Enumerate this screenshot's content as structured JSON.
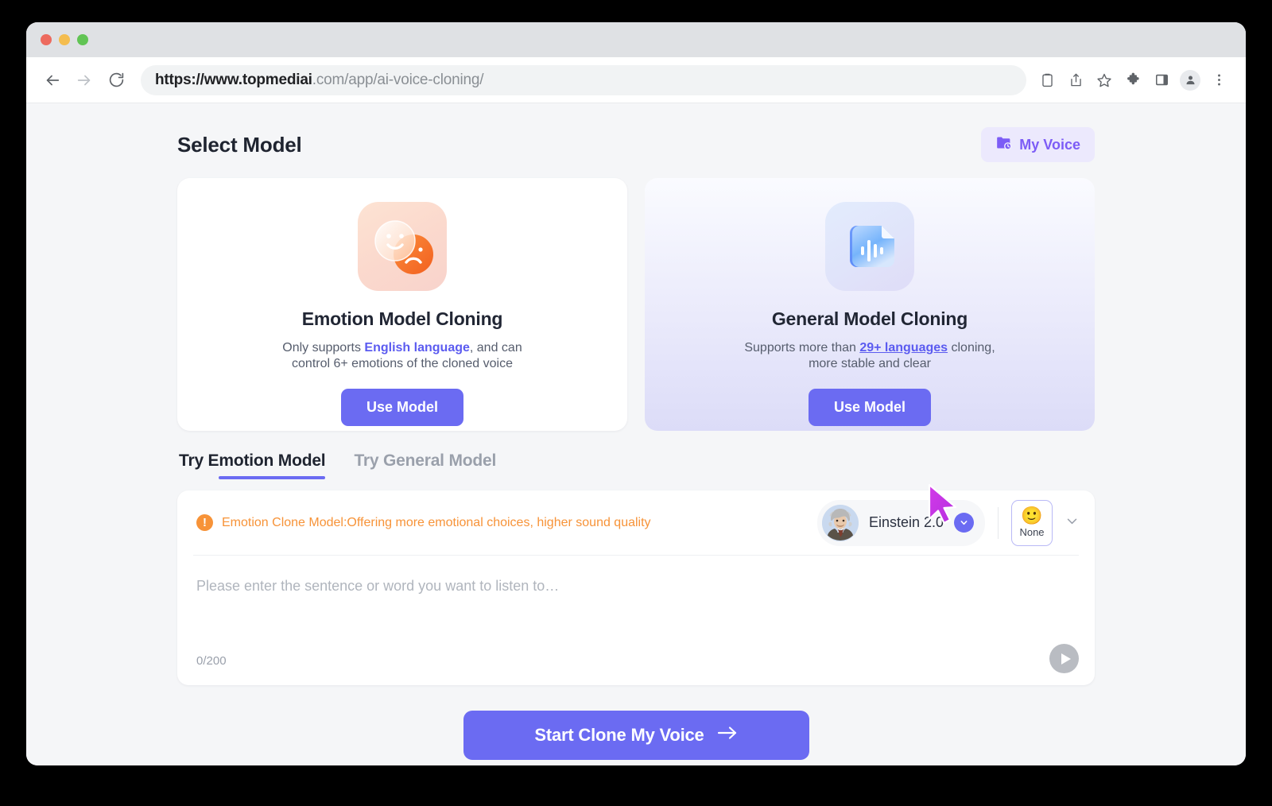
{
  "browser": {
    "traffic_lights": [
      "close",
      "minimize",
      "maximize"
    ],
    "back_icon": "arrow-left-icon",
    "forward_icon": "arrow-right-icon",
    "reload_icon": "reload-icon",
    "url_strong": "https://www.topmediai",
    "url_rest": ".com/app/ai-voice-cloning/",
    "toolbar_icons": [
      "clipboard-icon",
      "share-icon",
      "star-icon",
      "extensions-icon",
      "side-panel-icon",
      "profile-avatar-icon",
      "more-menu-icon"
    ]
  },
  "header": {
    "title": "Select Model",
    "my_voice_label": "My Voice",
    "my_voice_icon": "folder-clock-icon",
    "accent": "#7c5cf6"
  },
  "cards": [
    {
      "id": "emotion",
      "icon_name": "emotion-faces-icon",
      "title": "Emotion Model Cloning",
      "desc_before": "Only supports ",
      "desc_link": "English language",
      "desc_after": ", and can control 6+ emotions of the cloned voice",
      "button_label": "Use Model",
      "selected": false
    },
    {
      "id": "general",
      "icon_name": "audio-document-icon",
      "title": "General Model Cloning",
      "desc_before": "Supports more than ",
      "desc_link": "29+ languages",
      "desc_after": " cloning, more stable and clear",
      "button_label": "Use Model",
      "selected": true
    }
  ],
  "tabs": [
    {
      "label": "Try Emotion Model",
      "active": true
    },
    {
      "label": "Try General Model",
      "active": false
    }
  ],
  "panel": {
    "notice_icon": "exclamation-circle-icon",
    "notice_text": "Emotion Clone Model:Offering more emotional choices, higher sound quality",
    "notice_color": "#f79338",
    "voice": {
      "avatar_name": "einstein-avatar",
      "name": "Einstein 2.0",
      "chevron_icon": "chevron-down-icon"
    },
    "emotion": {
      "emoji": "🙂",
      "label": "None",
      "chevron_icon": "chevron-down-icon"
    },
    "textarea_placeholder": "Please enter the sentence or word you want to listen to…",
    "textarea_value": "",
    "counter": "0/200",
    "play_icon": "play-icon"
  },
  "cta": {
    "label": "Start Clone My Voice",
    "arrow": "→",
    "color": "#6b6bf2"
  },
  "cursor": {
    "icon": "mouse-pointer-icon",
    "color": "#cc35e0"
  }
}
